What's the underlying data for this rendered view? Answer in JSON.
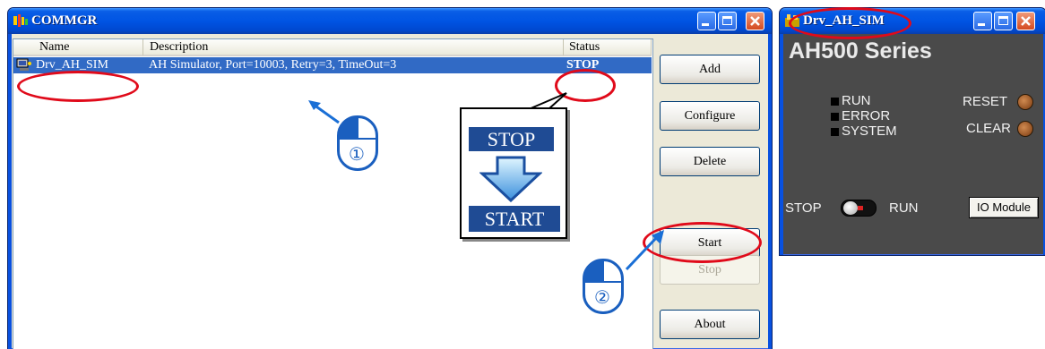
{
  "commgr": {
    "title": "COMMGR",
    "columns": {
      "name": "Name",
      "description": "Description",
      "status": "Status"
    },
    "rows": [
      {
        "name": "Drv_AH_SIM",
        "description": "AH Simulator, Port=10003, Retry=3, TimeOut=3",
        "status": "STOP"
      }
    ],
    "buttons": {
      "add": "Add",
      "configure": "Configure",
      "delete": "Delete",
      "start": "Start",
      "stop": "Stop",
      "about": "About"
    }
  },
  "simulator": {
    "title": "Drv_AH_SIM",
    "heading": "AH500 Series",
    "leds": {
      "run": "RUN",
      "error": "ERROR",
      "system": "SYSTEM"
    },
    "reset_label": "RESET",
    "clear_label": "CLEAR",
    "switch": {
      "stop": "STOP",
      "run": "RUN"
    },
    "io_button": "IO Module"
  },
  "annotations": {
    "callout_from": "STOP",
    "callout_to": "START",
    "step1": "①",
    "step2": "②"
  },
  "colors": {
    "titlebar": "#0054e3",
    "selection": "#316ac5",
    "highlight_ellipse": "#e00a1a",
    "callout_box": "#1f4b94",
    "simulator_bg": "#4a4a4a"
  }
}
